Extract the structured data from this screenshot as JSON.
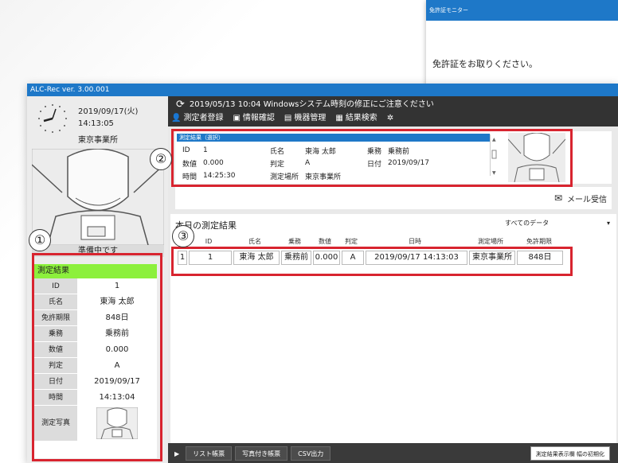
{
  "app": {
    "title": "ALC-Rec  ver. 3.00.001",
    "date": "2019/09/17(火)",
    "time": "14:13:05",
    "office": "東京事業所",
    "status": "準備中です"
  },
  "notice": "2019/05/13 10:04 Windowsシステム時刻の修正にご注意ください",
  "menu": [
    {
      "label": "測定者登録",
      "icon": "person-icon"
    },
    {
      "label": "情報確認",
      "icon": "id-card-icon"
    },
    {
      "label": "機器管理",
      "icon": "device-icon"
    },
    {
      "label": "結果検索",
      "icon": "calendar-icon"
    }
  ],
  "result_panel": {
    "title": "測定結果",
    "rows": [
      {
        "key": "ID",
        "value": "1"
      },
      {
        "key": "氏名",
        "value": "東海 太郎"
      },
      {
        "key": "免許期限",
        "value": "848日"
      },
      {
        "key": "乗務",
        "value": "乗務前"
      },
      {
        "key": "数値",
        "value": "0.000"
      },
      {
        "key": "判定",
        "value": "A"
      },
      {
        "key": "日付",
        "value": "2019/09/17"
      },
      {
        "key": "時間",
        "value": "14:13:04"
      }
    ],
    "photo_label": "測定写真"
  },
  "selected": {
    "title": "測定結果（選択）",
    "id_label": "ID",
    "id": "1",
    "name_label": "氏名",
    "name": "東海 太郎",
    "duty_label": "乗務",
    "duty": "乗務前",
    "value_label": "数値",
    "value": "0.000",
    "judge_label": "判定",
    "judge": "A",
    "date_label": "日付",
    "date": "2019/09/17",
    "time_label": "時間",
    "time": "14:25:30",
    "place_label": "測定場所",
    "place": "東京事業所"
  },
  "mail_button": "メール受信",
  "today": {
    "title": "本日の測定結果",
    "filter": "すべてのデータ",
    "columns": [
      "",
      "ID",
      "氏名",
      "乗務",
      "数値",
      "判定",
      "日時",
      "測定場所",
      "免許期限"
    ],
    "rows": [
      [
        "1",
        "1",
        "東海 太郎",
        "乗務前",
        "0.000",
        "A",
        "2019/09/17 14:13:03",
        "東京事業所",
        "848日"
      ]
    ]
  },
  "bottom": {
    "buttons": [
      "リスト帳票",
      "写真付き帳票",
      "CSV出力"
    ],
    "reset": "測定結果表示欄 幅の初期化"
  },
  "monitor": {
    "title": "免許証モニター",
    "message": "免許証をお取りください。"
  },
  "markers": [
    "①",
    "②",
    "③"
  ],
  "colors": {
    "accent": "#1e78c8",
    "highlight": "#8cf03c",
    "annotation": "#d8242f"
  }
}
